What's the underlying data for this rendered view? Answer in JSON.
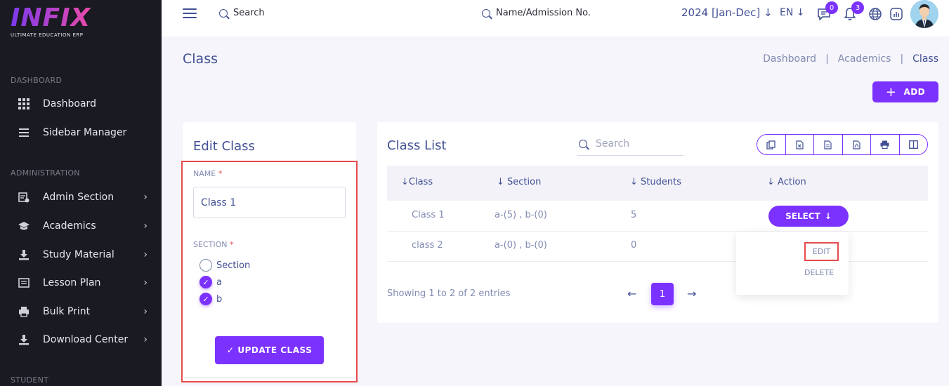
{
  "brand": {
    "name": "INFIX",
    "tagline": "ULTIMATE EDUCATION ERP"
  },
  "sidebar": {
    "sections": [
      {
        "label": "DASHBOARD"
      },
      {
        "label": "ADMINISTRATION"
      },
      {
        "label": "STUDENT"
      }
    ],
    "items": [
      {
        "label": "Dashboard",
        "icon": "grid-icon",
        "chevron": false
      },
      {
        "label": "Sidebar Manager",
        "icon": "list-icon",
        "chevron": false
      },
      {
        "label": "Admin Section",
        "icon": "admin-icon",
        "chevron": true
      },
      {
        "label": "Academics",
        "icon": "graduation-cap-icon",
        "chevron": true
      },
      {
        "label": "Study Material",
        "icon": "download-icon",
        "chevron": true
      },
      {
        "label": "Lesson Plan",
        "icon": "book-icon",
        "chevron": true
      },
      {
        "label": "Bulk Print",
        "icon": "printer-icon",
        "chevron": true
      },
      {
        "label": "Download Center",
        "icon": "download-icon",
        "chevron": true
      }
    ]
  },
  "topbar": {
    "search_label": "Search",
    "search2_label": "Name/Admission No.",
    "session": "2024 [Jan-Dec]",
    "language": "EN",
    "messages_count": "0",
    "notifications_count": "3"
  },
  "page": {
    "title": "Class",
    "breadcrumb": [
      "Dashboard",
      "Academics",
      "Class"
    ],
    "add_label": "ADD"
  },
  "edit_form": {
    "title": "Edit Class",
    "name_label": "NAME",
    "name_value": "Class 1",
    "section_label": "SECTION",
    "required_mark": "*",
    "options": [
      {
        "label": "Section",
        "checked": false
      },
      {
        "label": "a",
        "checked": true
      },
      {
        "label": "b",
        "checked": true
      }
    ],
    "submit_label": "UPDATE CLASS"
  },
  "class_list": {
    "title": "Class List",
    "search_placeholder": "Search",
    "columns": [
      "Class",
      "Section",
      "Students",
      "Action"
    ],
    "rows": [
      {
        "class": "Class 1",
        "section": "a-(5) , b-(0)",
        "students": "5"
      },
      {
        "class": "class 2",
        "section": "a-(0) , b-(0)",
        "students": "0"
      }
    ],
    "select_label": "SELECT",
    "dropdown": {
      "edit": "EDIT",
      "delete": "DELETE"
    },
    "showing": "Showing 1 to 2 of 2 entries",
    "current_page": "1"
  },
  "colors": {
    "accent": "#7c32ff",
    "text": "#415094",
    "sidebar": "#1a1a22",
    "highlight": "#e74c4c"
  }
}
